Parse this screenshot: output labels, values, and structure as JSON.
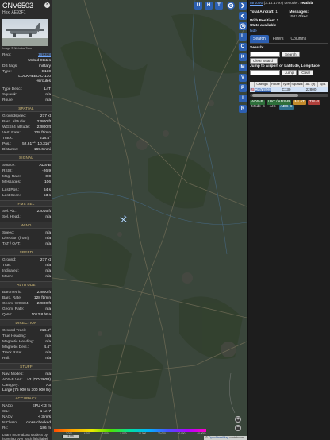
{
  "info": {
    "callsign": "CNV6503",
    "hex_label": "Hex:",
    "hex": "AE93F1",
    "close_glyph": "×",
    "photo_credit": "Image © Nicholas Tsou",
    "reg_label": "Reg.:",
    "reg": "165378",
    "country": "United States",
    "db_flags_label": "DB flags:",
    "db_flags": "military",
    "type_label": "Type:",
    "type": "C130",
    "type_name": "LOCKHEED C-130 Hercules",
    "type_desc_label": "Type Desc.:",
    "type_desc": "L4T",
    "squawk_label": "Squawk:",
    "squawk": "n/a",
    "route_label": "Route:",
    "route": "n/a"
  },
  "spatial": {
    "title": "SPATIAL",
    "rows": [
      {
        "k": "Groundspeed:",
        "v": "277 kt"
      },
      {
        "k": "Baro. altitude:",
        "v": "22800 ft"
      },
      {
        "k": "WGS84 altitude:",
        "v": "22800 ft"
      },
      {
        "k": "Vert. Rate:",
        "v": "128 ft/min"
      },
      {
        "k": "Track:",
        "v": "218.4°"
      },
      {
        "k": "Pos.:",
        "v": "52.617°, 10.316°"
      },
      {
        "k": "Distance:",
        "v": "169.6 nmi"
      }
    ]
  },
  "signal": {
    "title": "SIGNAL",
    "rows": [
      {
        "k": "Source:",
        "v": "ADS-B"
      },
      {
        "k": "RSSI:",
        "v": "-26.9"
      },
      {
        "k": "Msg. Rate:",
        "v": "0.0"
      },
      {
        "k": "Messages:",
        "v": "106"
      }
    ],
    "rows2": [
      {
        "k": "Last Pos.:",
        "v": "64 s"
      },
      {
        "k": "Last Seen:",
        "v": "53 s"
      }
    ]
  },
  "fms": {
    "title": "FMS SEL",
    "rows": [
      {
        "k": "Sel. Alt.:",
        "v": "22016 ft"
      },
      {
        "k": "Sel. Head.:",
        "v": "n/a"
      }
    ]
  },
  "wind": {
    "title": "WIND",
    "rows": [
      {
        "k": "Speed:",
        "v": "n/a"
      },
      {
        "k": "Direction (from):",
        "v": "n/a"
      },
      {
        "k": "TAT / OAT:",
        "v": "n/a"
      }
    ]
  },
  "speed": {
    "title": "SPEED",
    "rows": [
      {
        "k": "Ground:",
        "v": "277 kt"
      },
      {
        "k": "True:",
        "v": "n/a"
      },
      {
        "k": "Indicated:",
        "v": "n/a"
      },
      {
        "k": "Mach:",
        "v": "n/a"
      }
    ]
  },
  "altitude": {
    "title": "ALTITUDE",
    "rows": [
      {
        "k": "Barometric:",
        "v": "22800 ft"
      },
      {
        "k": "Baro. Rate:",
        "v": "128 ft/min"
      },
      {
        "k": "Geom. WGS84:",
        "v": "22800 ft"
      },
      {
        "k": "Geom. Rate:",
        "v": "n/a"
      },
      {
        "k": "QNH:",
        "v": "1012.8 hPa"
      }
    ]
  },
  "direction": {
    "title": "DIRECTION",
    "rows": [
      {
        "k": "Ground Track:",
        "v": "218.4°"
      },
      {
        "k": "True Heading:",
        "v": "n/a"
      },
      {
        "k": "Magnetic Heading:",
        "v": "n/a"
      },
      {
        "k": "Magnetic Decl.:",
        "v": "4.4°"
      },
      {
        "k": "Track Rate:",
        "v": "n/a"
      },
      {
        "k": "Roll:",
        "v": "n/a"
      }
    ]
  },
  "stuff": {
    "title": "STUFF",
    "rows": [
      {
        "k": "Nav. Modes:",
        "v": "n/a"
      },
      {
        "k": "ADS-B Ver.:",
        "v": "v2 (DO-260B)"
      },
      {
        "k": "Category:",
        "v": "A3"
      }
    ],
    "category_desc": "Large (75 000 to 300 000 lb)"
  },
  "accuracy": {
    "title": "ACCURACY",
    "rows": [
      {
        "k": "NACp:",
        "v": "EPU < 3 m"
      },
      {
        "k": "SIL:",
        "v": "≤ 1e-7"
      },
      {
        "k": "NACv:",
        "v": "< 3 m/s"
      },
      {
        "k": "NICbaro:",
        "v": "cross-checked"
      },
      {
        "k": "Rc:",
        "v": "186 m"
      }
    ]
  },
  "learn_more": "Learn more about Mode S by hovering over each field label",
  "map": {
    "buttons": [
      "U",
      "H",
      "T"
    ],
    "top_icon": "settings-icon",
    "zoom_in": "+",
    "zoom_out": "−",
    "scale": "5 nm",
    "attribution_prefix": "© ",
    "attribution_link": "OpenStreetMap",
    "attribution_suffix": " contributors.",
    "altitude_ticks": [
      "",
      "2 000",
      "4 000",
      "6 000",
      "8 000",
      "10 000",
      "20 000",
      "30 000",
      "40 000+"
    ]
  },
  "side_buttons": [
    "L",
    "O",
    "K",
    "M",
    "V",
    "P",
    "I",
    "R"
  ],
  "side": {
    "version_link": "tar1090",
    "version": "(3.14.1797) decoder:",
    "decoder": "readsb",
    "total_aircraft_label": "Total Aircraft:",
    "total_aircraft": "1",
    "messages_label": "Messages:",
    "messages": "1517.0/sec",
    "with_position_label": "With Position:",
    "with_position": "1",
    "stats_label": "Stats available",
    "toggle_label": "hide",
    "tabs": [
      "Search",
      "Filters",
      "Columns"
    ],
    "search_label": "Search:",
    "search_button": "Search",
    "clear_search_button": "Clear Search",
    "jump_label": "Jump to Airport or Latitude, Longitude:",
    "jump_button": "Jump",
    "clear_button": "Clear",
    "table_headers": [
      "",
      "Callsign",
      "Route",
      "Type",
      "Squawk",
      "Alt. (ft)",
      "Spd."
    ],
    "table_rows": [
      {
        "flag": "🇺🇸",
        "callsign": "CNV6503",
        "route": "",
        "type": "C130",
        "squawk": "",
        "alt": "22800",
        "spd": ""
      }
    ],
    "filter_chips": [
      "ADS-B",
      "UAT / ADS-R",
      "MLAT",
      "TIS-B",
      "Mode-S",
      "AIS",
      "ADS-C"
    ]
  },
  "colors": {
    "accent": "#2c5fb1",
    "section_title": "#d9c27c",
    "map_bg": "#39453a",
    "aircraft": "#bfe3ff"
  }
}
